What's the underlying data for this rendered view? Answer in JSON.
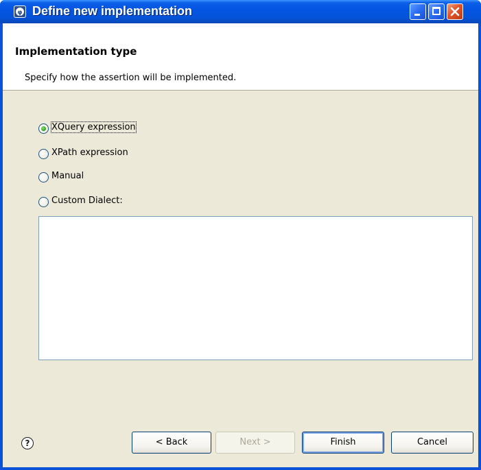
{
  "window": {
    "title": "Define new implementation"
  },
  "header": {
    "title": "Implementation type",
    "description": "Specify how the assertion will be implemented."
  },
  "options": [
    {
      "label": "XQuery expression",
      "checked": true
    },
    {
      "label": "XPath expression",
      "checked": false
    },
    {
      "label": "Manual",
      "checked": false
    },
    {
      "label": "Custom Dialect:",
      "checked": false
    }
  ],
  "custom_dialect_value": "",
  "buttons": {
    "help": "?",
    "back": "< Back",
    "next": "Next >",
    "finish": "Finish",
    "cancel": "Cancel"
  },
  "colors": {
    "titlebar": "#0554e3",
    "client_bg": "#ece9d8",
    "radio_dot": "#39a521"
  }
}
